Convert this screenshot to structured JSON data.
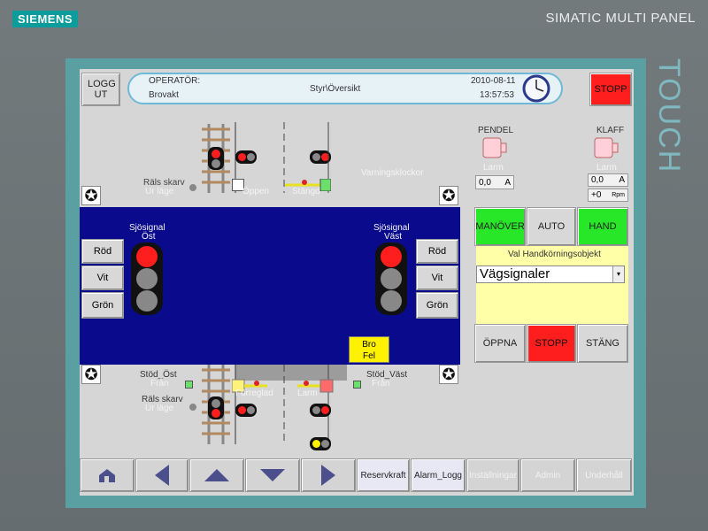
{
  "bezel": {
    "brand": "SIEMENS",
    "model": "SIMATIC MULTI PANEL",
    "touch": "TOUCH"
  },
  "header": {
    "logout_label": "LOGG UT",
    "operator_label": "OPERATÖR:",
    "operator_name": "Brovakt",
    "breadcrumb": "Styr\\Översikt",
    "date": "2010-08-11",
    "time": "13:57:53",
    "stop_label": "STOPP"
  },
  "track_area": {
    "rail_joint_top": "Räls skarv",
    "rail_joint_top_state": "Ur läge",
    "open_label": "Öppen",
    "closed_label": "Stängd",
    "warning_bells": "Varningsklockor",
    "rail_joint_bottom": "Räls skarv",
    "rail_joint_bottom_state": "Ur läge",
    "support_east": "Stöd_Öst",
    "support_east_state": "Från",
    "support_west": "Stöd_Väst",
    "support_west_state": "Från",
    "locked_label": "Förreglad",
    "alarm_label": "Larm"
  },
  "sea_signals": {
    "east_title": "Sjösignal",
    "east_sub": "Öst",
    "west_title": "Sjösignal",
    "west_sub": "Väst",
    "buttons": [
      "Röd",
      "Vit",
      "Grön"
    ],
    "bridge_fault": "Bro\nFel"
  },
  "motors": {
    "pendel_label": "PENDEL",
    "pendel_alarm": "Larm",
    "pendel_value": "0,0",
    "pendel_unit": "A",
    "klaff_label": "KLAFF",
    "klaff_alarm": "Larm",
    "klaff_value": "0,0",
    "klaff_unit": "A",
    "klaff_rpm_value": "+0",
    "klaff_rpm_unit": "Rpm"
  },
  "mode": {
    "maneuver": "MANÖVER",
    "auto": "AUTO",
    "hand": "HAND",
    "object_label": "Val Handkörningsobjekt",
    "object_value": "Vägsignaler",
    "open": "ÖPPNA",
    "stop": "STOPP",
    "close": "STÄNG"
  },
  "nav": {
    "reserve_power": "Reservkraft",
    "alarm_log": "Alarm_Logg",
    "settings": "Inställningar",
    "admin": "Admin",
    "maintenance": "Underhåll"
  },
  "colors": {
    "accent_teal": "#5aa0a2",
    "signal_red": "#ff1e1e",
    "ok_green": "#28e628",
    "sea_blue": "#0a0a8c"
  }
}
